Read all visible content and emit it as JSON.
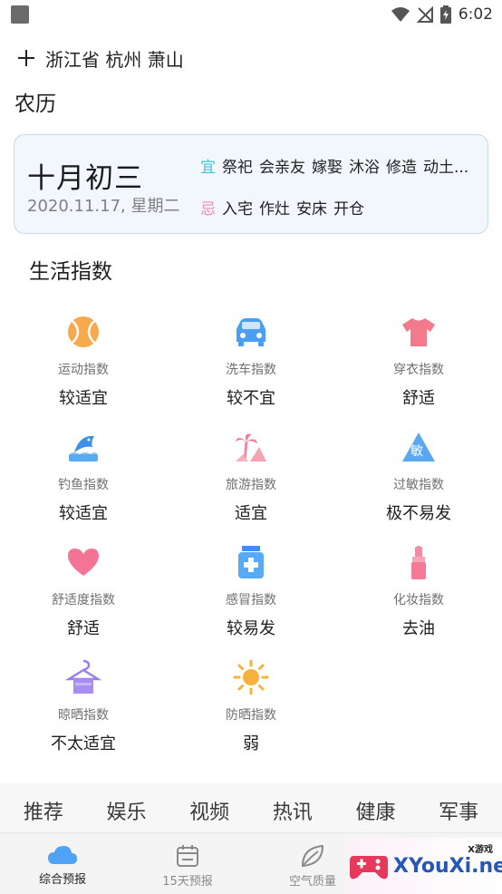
{
  "status_bar": {
    "time": "6:02"
  },
  "location": {
    "text": "浙江省 杭州 萧山"
  },
  "lunar_section": {
    "title": "农历"
  },
  "almanac": {
    "lunar_date": "十月初三",
    "solar_date": "2020.11.17, 星期二",
    "yi_label": "宜",
    "yi_items": [
      "祭祀",
      "会亲友",
      "嫁娶",
      "沐浴",
      "修造",
      "动土..."
    ],
    "ji_label": "忌",
    "ji_items": [
      "入宅",
      "作灶",
      "安床",
      "开仓"
    ]
  },
  "life_section": {
    "title": "生活指数",
    "items": [
      {
        "name": "运动指数",
        "value": "较适宜",
        "icon": "tennis-ball-icon"
      },
      {
        "name": "洗车指数",
        "value": "较不宜",
        "icon": "car-icon"
      },
      {
        "name": "穿衣指数",
        "value": "舒适",
        "icon": "tshirt-icon"
      },
      {
        "name": "钓鱼指数",
        "value": "较适宜",
        "icon": "fish-icon"
      },
      {
        "name": "旅游指数",
        "value": "适宜",
        "icon": "palm-tree-icon"
      },
      {
        "name": "过敏指数",
        "value": "极不易发",
        "icon": "allergy-icon"
      },
      {
        "name": "舒适度指数",
        "value": "舒适",
        "icon": "heart-icon"
      },
      {
        "name": "感冒指数",
        "value": "较易发",
        "icon": "medicine-bottle-icon"
      },
      {
        "name": "化妆指数",
        "value": "去油",
        "icon": "lipstick-icon"
      },
      {
        "name": "晾晒指数",
        "value": "不太适宜",
        "icon": "clothes-hanger-icon"
      },
      {
        "name": "防晒指数",
        "value": "弱",
        "icon": "sun-icon"
      }
    ],
    "allergy_icon_text": "敏"
  },
  "news_tabs": [
    "推荐",
    "娱乐",
    "视频",
    "热讯",
    "健康",
    "军事"
  ],
  "bottom_nav": [
    {
      "label": "综合预报",
      "icon": "cloud-icon"
    },
    {
      "label": "15天预报",
      "icon": "calendar-icon"
    },
    {
      "label": "空气质量",
      "icon": "leaf-icon"
    }
  ],
  "watermark": {
    "brand": "XYouXi.net",
    "sub": "X游戏"
  },
  "colors": {
    "yi": "#40c6d6",
    "ji": "#f38db9",
    "card_border": "#c7d8ef",
    "card_bg": "#f2f7fe"
  }
}
